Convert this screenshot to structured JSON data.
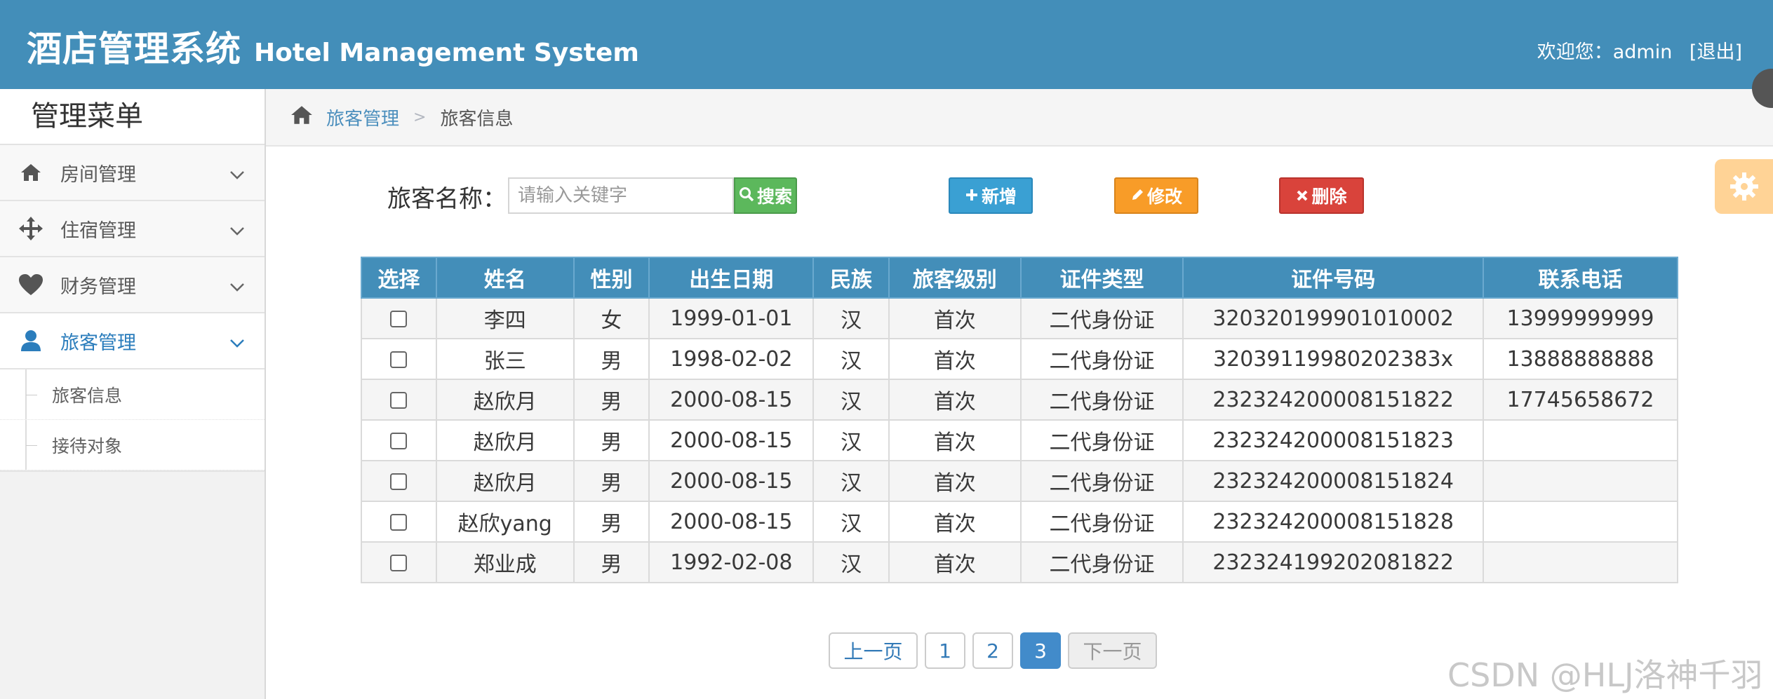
{
  "header": {
    "title_cn": "酒店管理系统",
    "title_en": "Hotel Management System",
    "welcome": "欢迎您：admin",
    "logout": "[退出]",
    "bg_color": "#438eb9"
  },
  "sidebar": {
    "title": "管理菜单",
    "items": [
      {
        "label": "房间管理",
        "icon": "home-icon"
      },
      {
        "label": "住宿管理",
        "icon": "move-icon"
      },
      {
        "label": "财务管理",
        "icon": "heart-icon"
      },
      {
        "label": "旅客管理",
        "icon": "user-icon",
        "active": true
      }
    ],
    "sub_items": [
      "旅客信息",
      "接待对象"
    ]
  },
  "breadcrumb": {
    "parent": "旅客管理",
    "current": "旅客信息"
  },
  "search": {
    "label": "旅客名称：",
    "placeholder": "请输入关键字",
    "button": "搜索"
  },
  "toolbar": {
    "add": "新增",
    "edit": "修改",
    "delete": "删除"
  },
  "table": {
    "columns": [
      "选择",
      "姓名",
      "性别",
      "出生日期",
      "民族",
      "旅客级别",
      "证件类型",
      "证件号码",
      "联系电话"
    ],
    "rows": [
      [
        "李四",
        "女",
        "1999-01-01",
        "汉",
        "首次",
        "二代身份证",
        "320320199901010002",
        "13999999999"
      ],
      [
        "张三",
        "男",
        "1998-02-02",
        "汉",
        "首次",
        "二代身份证",
        "32039119980202383x",
        "13888888888"
      ],
      [
        "赵欣月",
        "男",
        "2000-08-15",
        "汉",
        "首次",
        "二代身份证",
        "232324200008151822",
        "17745658672"
      ],
      [
        "赵欣月",
        "男",
        "2000-08-15",
        "汉",
        "首次",
        "二代身份证",
        "232324200008151823",
        ""
      ],
      [
        "赵欣月",
        "男",
        "2000-08-15",
        "汉",
        "首次",
        "二代身份证",
        "232324200008151824",
        ""
      ],
      [
        "赵欣yang",
        "男",
        "2000-08-15",
        "汉",
        "首次",
        "二代身份证",
        "232324200008151828",
        ""
      ],
      [
        "郑业成",
        "男",
        "1992-02-08",
        "汉",
        "首次",
        "二代身份证",
        "232324199202081822",
        ""
      ]
    ]
  },
  "pager": {
    "prev": "上一页",
    "pages": [
      "1",
      "2",
      "3"
    ],
    "current": "3",
    "next": "下一页"
  },
  "watermark": "CSDN @HLJ洛神千羽"
}
